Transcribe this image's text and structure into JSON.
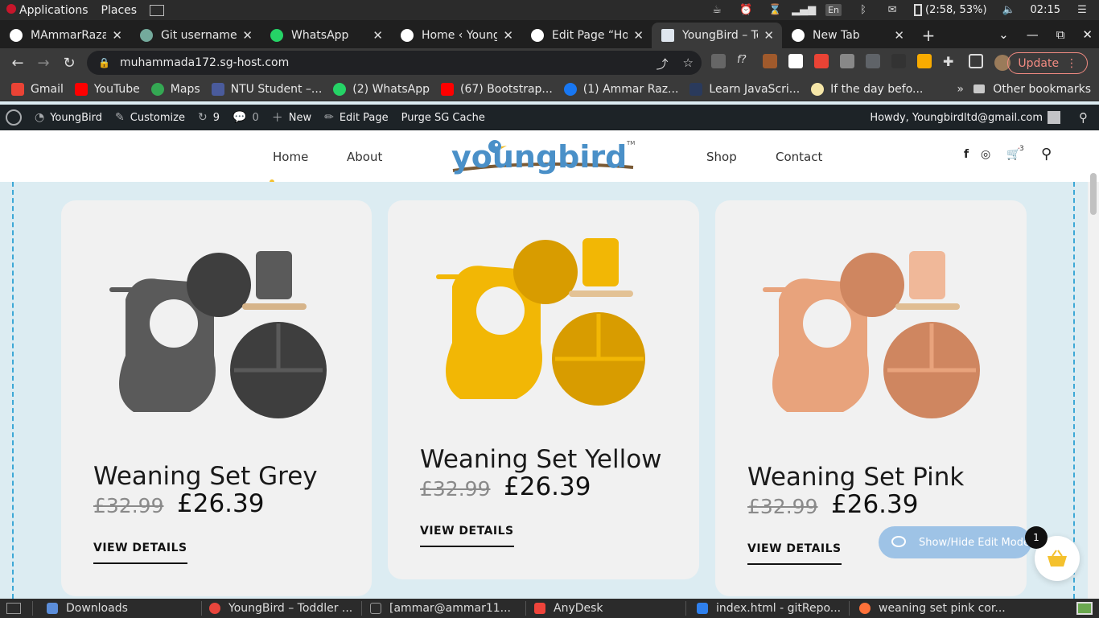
{
  "os_panel": {
    "menu": [
      "Applications",
      "Places"
    ],
    "battery": "(2:58, 53%)",
    "lang": "En",
    "clock": "02:15"
  },
  "tabs": [
    {
      "label": "MAmmarRaza/",
      "active": false
    },
    {
      "label": "Git username/",
      "active": false
    },
    {
      "label": "WhatsApp",
      "active": false
    },
    {
      "label": "Home ‹ Young",
      "active": false
    },
    {
      "label": "Edit Page “Hor",
      "active": false
    },
    {
      "label": "YoungBird – To",
      "active": true
    },
    {
      "label": "New Tab",
      "active": false
    }
  ],
  "address": {
    "url": "muhammada172.sg-host.com",
    "update_label": "Update"
  },
  "bookmarks": [
    "Gmail",
    "YouTube",
    "Maps",
    "NTU Student –...",
    "(2) WhatsApp",
    "(67) Bootstrap...",
    "(1) Ammar Raz...",
    "Learn JavaScri...",
    "If the day befo..."
  ],
  "bookmarks_more": "»",
  "bookmarks_other": "Other bookmarks",
  "wp_bar": {
    "site": "YoungBird",
    "customize": "Customize",
    "updates": "9",
    "comments": "0",
    "new": "New",
    "edit_page": "Edit Page",
    "purge": "Purge SG Cache",
    "howdy": "Howdy, Youngbirdltd@gmail.com"
  },
  "site_nav": {
    "home": "Home",
    "about": "About",
    "shop": "Shop",
    "contact": "Contact",
    "logo_text": "youngbird",
    "cart_count": "3"
  },
  "products": [
    {
      "title": "Weaning Set Grey",
      "old_price": "£32.99",
      "price": "£26.39",
      "cta": "VIEW DETAILS",
      "color": "#5a5a5a",
      "color_dark": "#3e3e3e"
    },
    {
      "title": "Weaning Set Yellow",
      "old_price": "£32.99",
      "price": "£26.39",
      "cta": "VIEW DETAILS",
      "color": "#f2b705",
      "color_dark": "#d89c00"
    },
    {
      "title": "Weaning Set Pink",
      "old_price": "£32.99",
      "price": "£26.39",
      "cta": "VIEW DETAILS",
      "color": "#e8a37c",
      "color_dark": "#cf8660"
    }
  ],
  "edit_mode": {
    "label": "Show/Hide Edit Mode",
    "badge": "1"
  },
  "taskbar": [
    "Downloads",
    "YoungBird – Toddler ...",
    "[ammar@ammar11...",
    "AnyDesk",
    "index.html - gitRepo...",
    "weaning set pink cor..."
  ]
}
